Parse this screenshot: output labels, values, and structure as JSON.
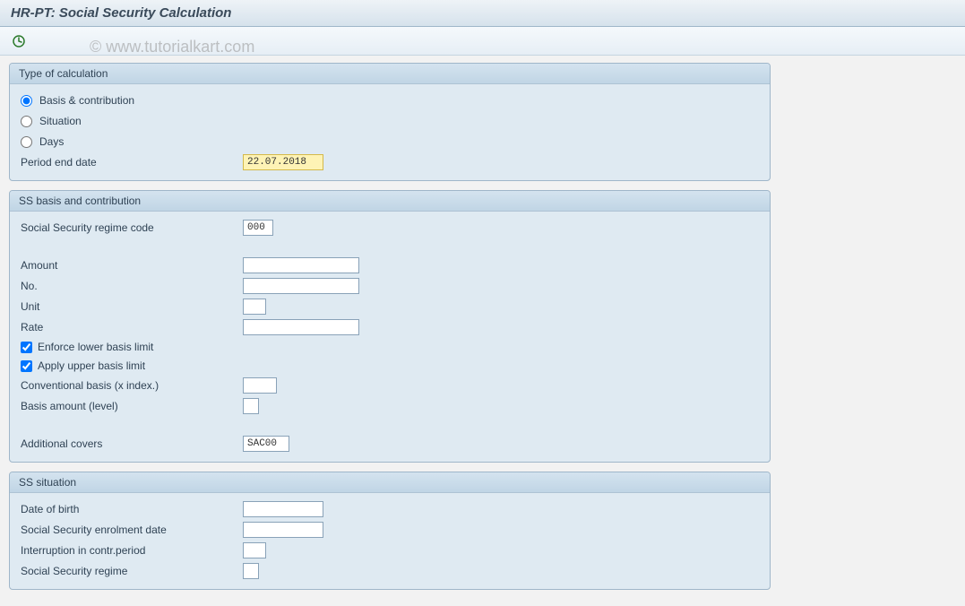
{
  "page_title": "HR-PT: Social Security Calculation",
  "watermark": "© www.tutorialkart.com",
  "groups": {
    "calc_type": {
      "title": "Type of calculation",
      "basis_contribution": "Basis & contribution",
      "situation": "Situation",
      "days": "Days",
      "period_end_label": "Period end date",
      "period_end_value": "22.07.2018"
    },
    "ss_basis": {
      "title": "SS basis and contribution",
      "regime_code_label": "Social Security regime code",
      "regime_code_value": "000",
      "amount_label": "Amount",
      "amount_value": "",
      "no_label": "No.",
      "no_value": "",
      "unit_label": "Unit",
      "unit_value": "",
      "rate_label": "Rate",
      "rate_value": "",
      "enforce_lower_label": "Enforce lower basis limit",
      "apply_upper_label": "Apply upper basis limit",
      "conventional_basis_label": "Conventional basis (x index.)",
      "conventional_basis_value": "",
      "basis_amount_label": "Basis amount (level)",
      "basis_amount_value": "",
      "additional_covers_label": "Additional covers",
      "additional_covers_value": "SAC00"
    },
    "ss_situation": {
      "title": "SS situation",
      "dob_label": "Date of birth",
      "dob_value": "",
      "enrolment_label": "Social Security enrolment date",
      "enrolment_value": "",
      "interruption_label": "Interruption in contr.period",
      "interruption_value": "",
      "regime_label": "Social Security regime",
      "regime_value": ""
    }
  }
}
